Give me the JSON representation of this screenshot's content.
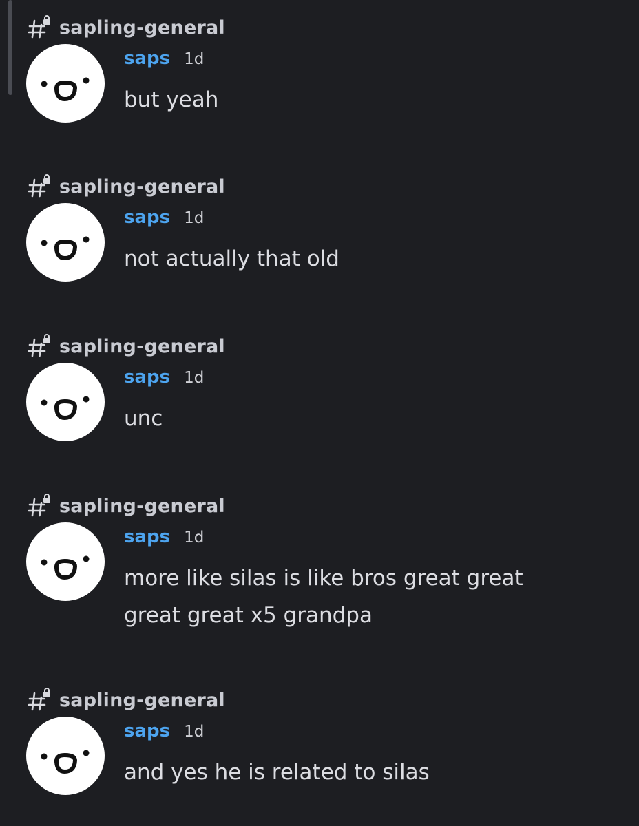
{
  "colors": {
    "background": "#1d1e22",
    "username": "#4da4ef",
    "text": "#dcdde2",
    "channel": "#c9cbd2"
  },
  "icons": {
    "channel": "locked-text-channel-icon",
    "avatar": "smiley-face-avatar"
  },
  "messages": [
    {
      "channel": "sapling-general",
      "username": "saps",
      "timestamp": "1d",
      "text": "but yeah"
    },
    {
      "channel": "sapling-general",
      "username": "saps",
      "timestamp": "1d",
      "text": "not actually that old"
    },
    {
      "channel": "sapling-general",
      "username": "saps",
      "timestamp": "1d",
      "text": "unc"
    },
    {
      "channel": "sapling-general",
      "username": "saps",
      "timestamp": "1d",
      "text": "more like silas is like bros great great great great x5 grandpa"
    },
    {
      "channel": "sapling-general",
      "username": "saps",
      "timestamp": "1d",
      "text": "and yes he is related to silas"
    }
  ]
}
